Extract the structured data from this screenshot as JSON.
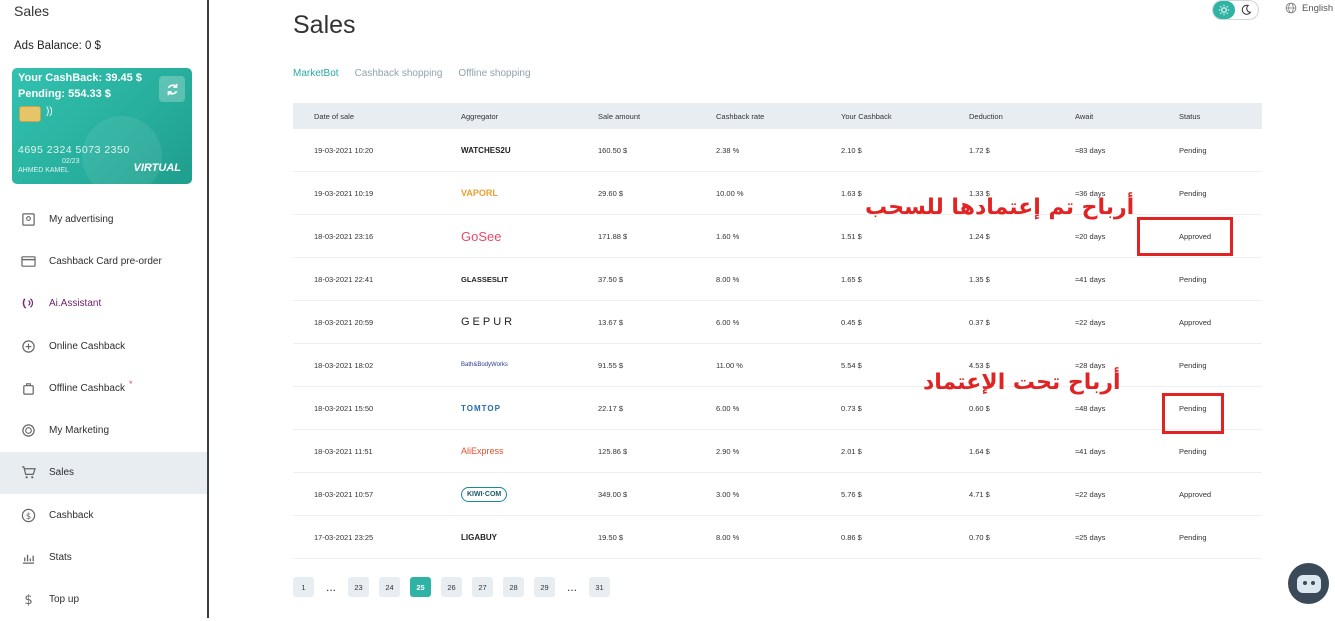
{
  "sidebar": {
    "title": "Sales",
    "ads_balance": "Ads Balance: 0 $",
    "card": {
      "cashback": "Your CashBack: 39.45 $",
      "pending": "Pending: 554.33 $",
      "number": "4695 2324 5073 2350",
      "expiry": "02/23",
      "holder": "AHMED KAMEL",
      "type": "VIRTUAL"
    },
    "items": [
      {
        "label": "My advertising",
        "icon": "advertising-icon"
      },
      {
        "label": "Cashback Card pre-order",
        "icon": "card-icon"
      },
      {
        "label": "Ai.Assistant",
        "icon": "ai-assistant-icon"
      },
      {
        "label": "Online Cashback",
        "icon": "online-cashback-icon"
      },
      {
        "label": "Offline Cashback",
        "icon": "bag-icon",
        "badge": "*"
      },
      {
        "label": "My Marketing",
        "icon": "marketing-icon"
      },
      {
        "label": "Sales",
        "icon": "cart-icon"
      },
      {
        "label": "Cashback",
        "icon": "dollar-circle-icon"
      },
      {
        "label": "Stats",
        "icon": "stats-icon"
      },
      {
        "label": "Top up",
        "icon": "dollar-icon"
      }
    ]
  },
  "header": {
    "title": "Sales",
    "language": "English",
    "tabs": [
      "MarketBot",
      "Cashback shopping",
      "Offline shopping"
    ]
  },
  "table": {
    "columns": [
      "Date of sale",
      "Aggregator",
      "Sale amount",
      "Cashback rate",
      "Your Cashback",
      "Deduction",
      "Await",
      "Status"
    ],
    "rows": [
      {
        "date": "19-03-2021 10:20",
        "agg": "WATCHES2U",
        "sale": "160.50 $",
        "rate": "2.38 %",
        "cash": "2.10 $",
        "ded": "1.72 $",
        "await": "≈83 days",
        "status": "Pending"
      },
      {
        "date": "19-03-2021 10:19",
        "agg": "VAPORL",
        "sale": "29.60 $",
        "rate": "10.00 %",
        "cash": "1.63 $",
        "ded": "1.33 $",
        "await": "≈36 days",
        "status": "Pending"
      },
      {
        "date": "18-03-2021 23:16",
        "agg": "GoSee",
        "sale": "171.88 $",
        "rate": "1.60 %",
        "cash": "1.51 $",
        "ded": "1.24 $",
        "await": "≈20 days",
        "status": "Approved"
      },
      {
        "date": "18-03-2021 22:41",
        "agg": "GLASSESLIT",
        "sale": "37.50 $",
        "rate": "8.00 %",
        "cash": "1.65 $",
        "ded": "1.35 $",
        "await": "≈41 days",
        "status": "Pending"
      },
      {
        "date": "18-03-2021 20:59",
        "agg": "GEPUR",
        "sale": "13.67 $",
        "rate": "6.00 %",
        "cash": "0.45 $",
        "ded": "0.37 $",
        "await": "≈22 days",
        "status": "Approved"
      },
      {
        "date": "18-03-2021 18:02",
        "agg": "Bath&BodyWorks",
        "sale": "91.55 $",
        "rate": "11.00 %",
        "cash": "5.54 $",
        "ded": "4.53 $",
        "await": "≈28 days",
        "status": "Pending"
      },
      {
        "date": "18-03-2021 15:50",
        "agg": "TOMTOP",
        "sale": "22.17 $",
        "rate": "6.00 %",
        "cash": "0.73 $",
        "ded": "0.60 $",
        "await": "≈48 days",
        "status": "Pending"
      },
      {
        "date": "18-03-2021 11:51",
        "agg": "AliExpress",
        "sale": "125.86 $",
        "rate": "2.90 %",
        "cash": "2.01 $",
        "ded": "1.64 $",
        "await": "≈41 days",
        "status": "Pending"
      },
      {
        "date": "18-03-2021 10:57",
        "agg": "KIWI·COM",
        "sale": "349.00 $",
        "rate": "3.00 %",
        "cash": "5.76 $",
        "ded": "4.71 $",
        "await": "≈22 days",
        "status": "Approved"
      },
      {
        "date": "17-03-2021 23:25",
        "agg": "LIGABUY",
        "sale": "19.50 $",
        "rate": "8.00 %",
        "cash": "0.86 $",
        "ded": "0.70 $",
        "await": "≈25 days",
        "status": "Pending"
      }
    ]
  },
  "pagination": [
    "1",
    "...",
    "23",
    "24",
    "25",
    "26",
    "27",
    "28",
    "29",
    "...",
    "31"
  ],
  "pagination_active": "25",
  "annotations": {
    "approved_note": "أرباح تم إعتمادها للسحب",
    "pending_note": "أرباح تحت الإعتماد"
  },
  "colors": {
    "accent": "#2fb3a4",
    "annotation": "#e02323",
    "header_bg": "#e8edf2"
  }
}
